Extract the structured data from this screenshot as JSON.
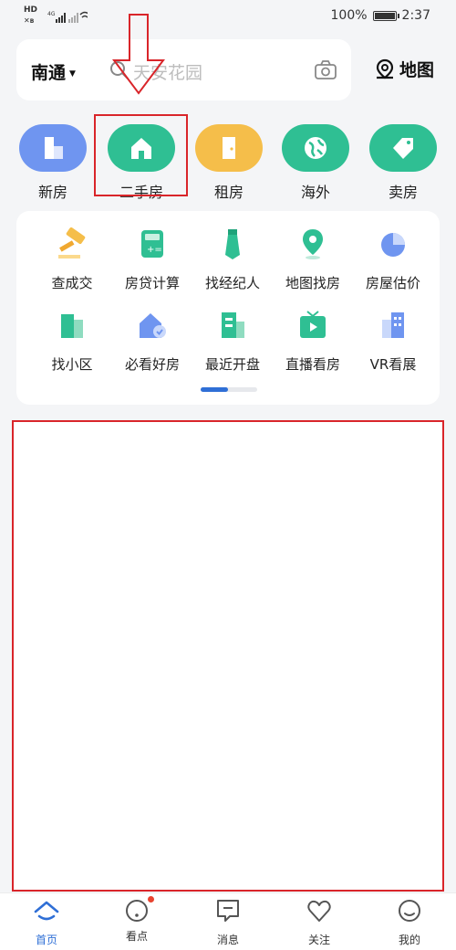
{
  "status_bar": {
    "left_badge_1": "HD",
    "left_badge_2": "4G",
    "battery": "100%",
    "time": "2:37"
  },
  "search": {
    "city": "南通",
    "placeholder": "天安花园"
  },
  "map_button": {
    "label": "地图"
  },
  "categories": [
    {
      "label": "新房",
      "color": "#6f95f0"
    },
    {
      "label": "二手房",
      "color": "#2fbf93"
    },
    {
      "label": "租房",
      "color": "#f5be4a"
    },
    {
      "label": "海外",
      "color": "#2fbf93"
    },
    {
      "label": "卖房",
      "color": "#2fbf93"
    }
  ],
  "services": [
    {
      "label": "查成交",
      "icon": "hammer-icon"
    },
    {
      "label": "房贷计算",
      "icon": "calculator-icon"
    },
    {
      "label": "找经纪人",
      "icon": "tie-icon"
    },
    {
      "label": "地图找房",
      "icon": "location-pin-icon"
    },
    {
      "label": "房屋估价",
      "icon": "pie-chart-icon"
    },
    {
      "label": "找小区",
      "icon": "community-icon"
    },
    {
      "label": "必看好房",
      "icon": "house-badge-icon"
    },
    {
      "label": "最近开盘",
      "icon": "building-icon"
    },
    {
      "label": "直播看房",
      "icon": "tv-play-icon"
    },
    {
      "label": "VR看展",
      "icon": "vr-building-icon"
    }
  ],
  "tabs": [
    {
      "label": "首页",
      "active": true
    },
    {
      "label": "看点",
      "active": false
    },
    {
      "label": "消息",
      "active": false
    },
    {
      "label": "关注",
      "active": false
    },
    {
      "label": "我的",
      "active": false
    }
  ],
  "colors": {
    "accent": "#2f6fd6",
    "annotation_red": "#d9252a",
    "green": "#2fbf93"
  }
}
